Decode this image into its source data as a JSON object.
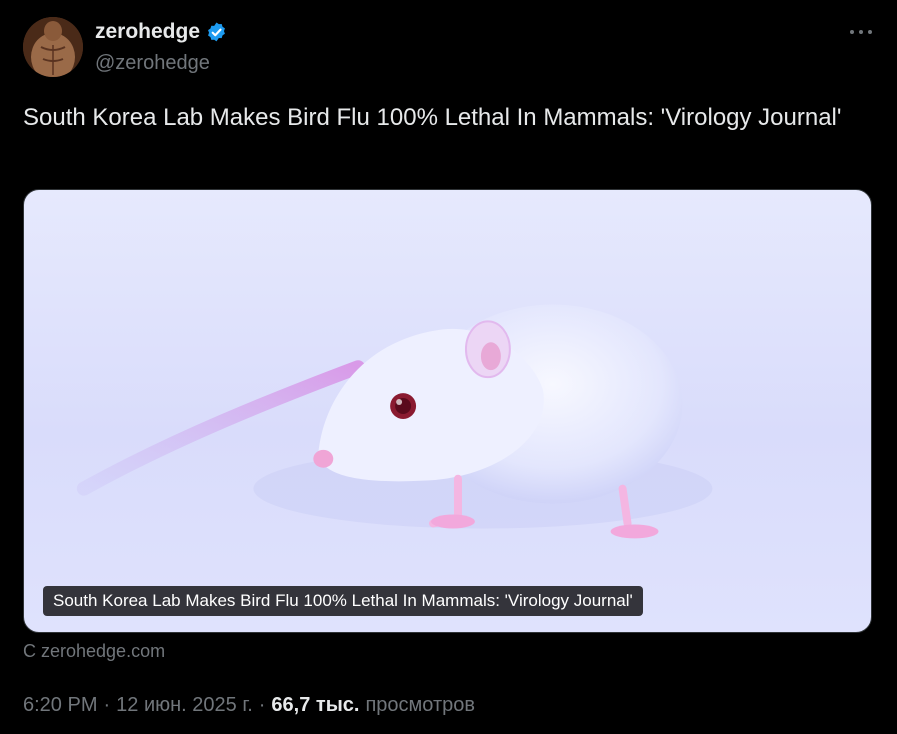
{
  "author": {
    "display_name": "zerohedge",
    "handle": "@zerohedge",
    "verified": true,
    "verified_color": "#1d9bf0"
  },
  "icons": {
    "more": "more-horizontal-icon",
    "verified": "verified-badge-icon"
  },
  "tweet": {
    "text": "South Korea Lab Makes Bird Flu 100% Lethal In Mammals: 'Virology Journal'"
  },
  "card": {
    "title": "South Korea Lab Makes Bird Flu 100% Lethal In Mammals: 'Virology Journal'",
    "source": "С zerohedge.com"
  },
  "meta": {
    "time": "6:20 PM",
    "separator": "·",
    "date": "12 июн. 2025 г.",
    "views_count": "66,7 тыс.",
    "views_label": "просмотров"
  },
  "colors": {
    "background": "#000000",
    "text_primary": "#e7e9ea",
    "text_secondary": "#71767b"
  }
}
